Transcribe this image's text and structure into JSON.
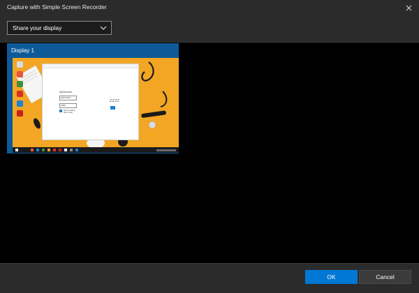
{
  "window": {
    "title": "Capture with Simple Screen Recorder"
  },
  "source_select": {
    "selected": "Share your display"
  },
  "displays": [
    {
      "label": "Display 1",
      "preview": {
        "app_title": "ZipScreen",
        "fields": [
          "SSR 1920",
          "1080"
        ],
        "checkbox_label": "Start recording when ready",
        "logo_text": "ZZZZ"
      }
    }
  ],
  "buttons": {
    "ok": "OK",
    "cancel": "Cancel"
  },
  "colors": {
    "accent": "#0078d4",
    "chrome": "#2b2b2b",
    "desktop": "#f2a623",
    "card": "#0e5a99"
  }
}
